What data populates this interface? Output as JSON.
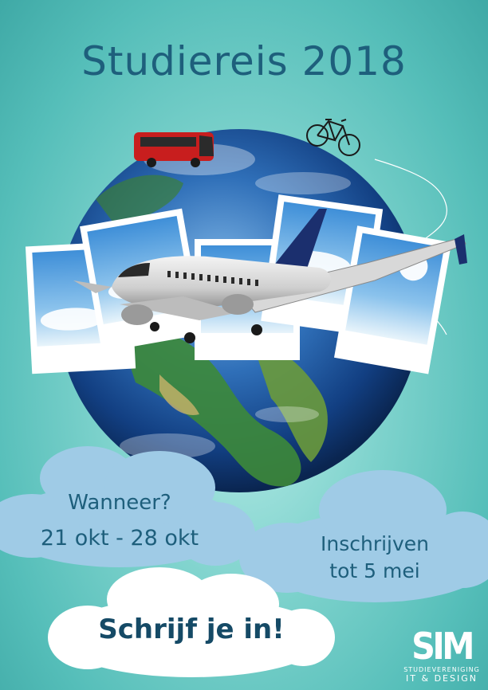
{
  "poster": {
    "title": "Studiereis 2018",
    "when_label": "Wanneer?",
    "dates": "21 okt - 28 okt",
    "signup_line1": "Inschrijven",
    "signup_line2": "tot 5 mei",
    "cta": "Schrijf je in!"
  },
  "logo": {
    "mark": "SIM",
    "line1": "STUDIEVERENIGING",
    "line2": "IT & DESIGN"
  },
  "colors": {
    "background": "#7fd3cd",
    "text": "#1e5f7c",
    "cloud": "#9fcbe6",
    "bus": "#c81e1e"
  }
}
